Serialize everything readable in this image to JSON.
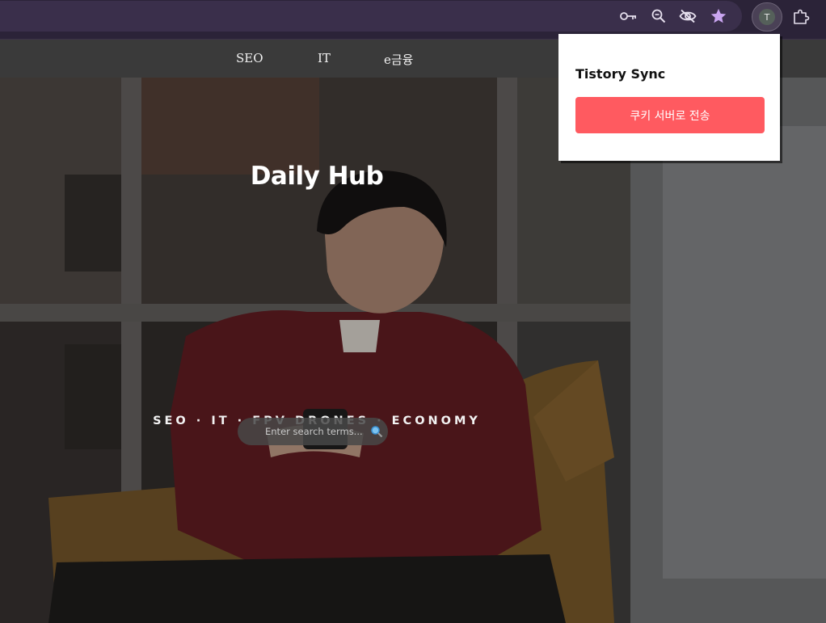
{
  "browser": {
    "toolbar_icons": [
      "key-icon",
      "zoom-out-icon",
      "eye-off-icon",
      "star-icon"
    ],
    "profile_initial": "T",
    "accent_color": "#c9a5f0"
  },
  "nav": {
    "items": [
      {
        "label": "SEO"
      },
      {
        "label": "IT"
      },
      {
        "label": "e금융"
      }
    ]
  },
  "hero": {
    "title": "Daily Hub",
    "tagline": "SEO · IT · FPV DRONES · ECONOMY"
  },
  "search": {
    "placeholder": "Enter search terms..."
  },
  "extension_popup": {
    "title": "Tistory Sync",
    "button_label": "쿠키 서버로 전송",
    "button_color": "#ff5a60"
  }
}
